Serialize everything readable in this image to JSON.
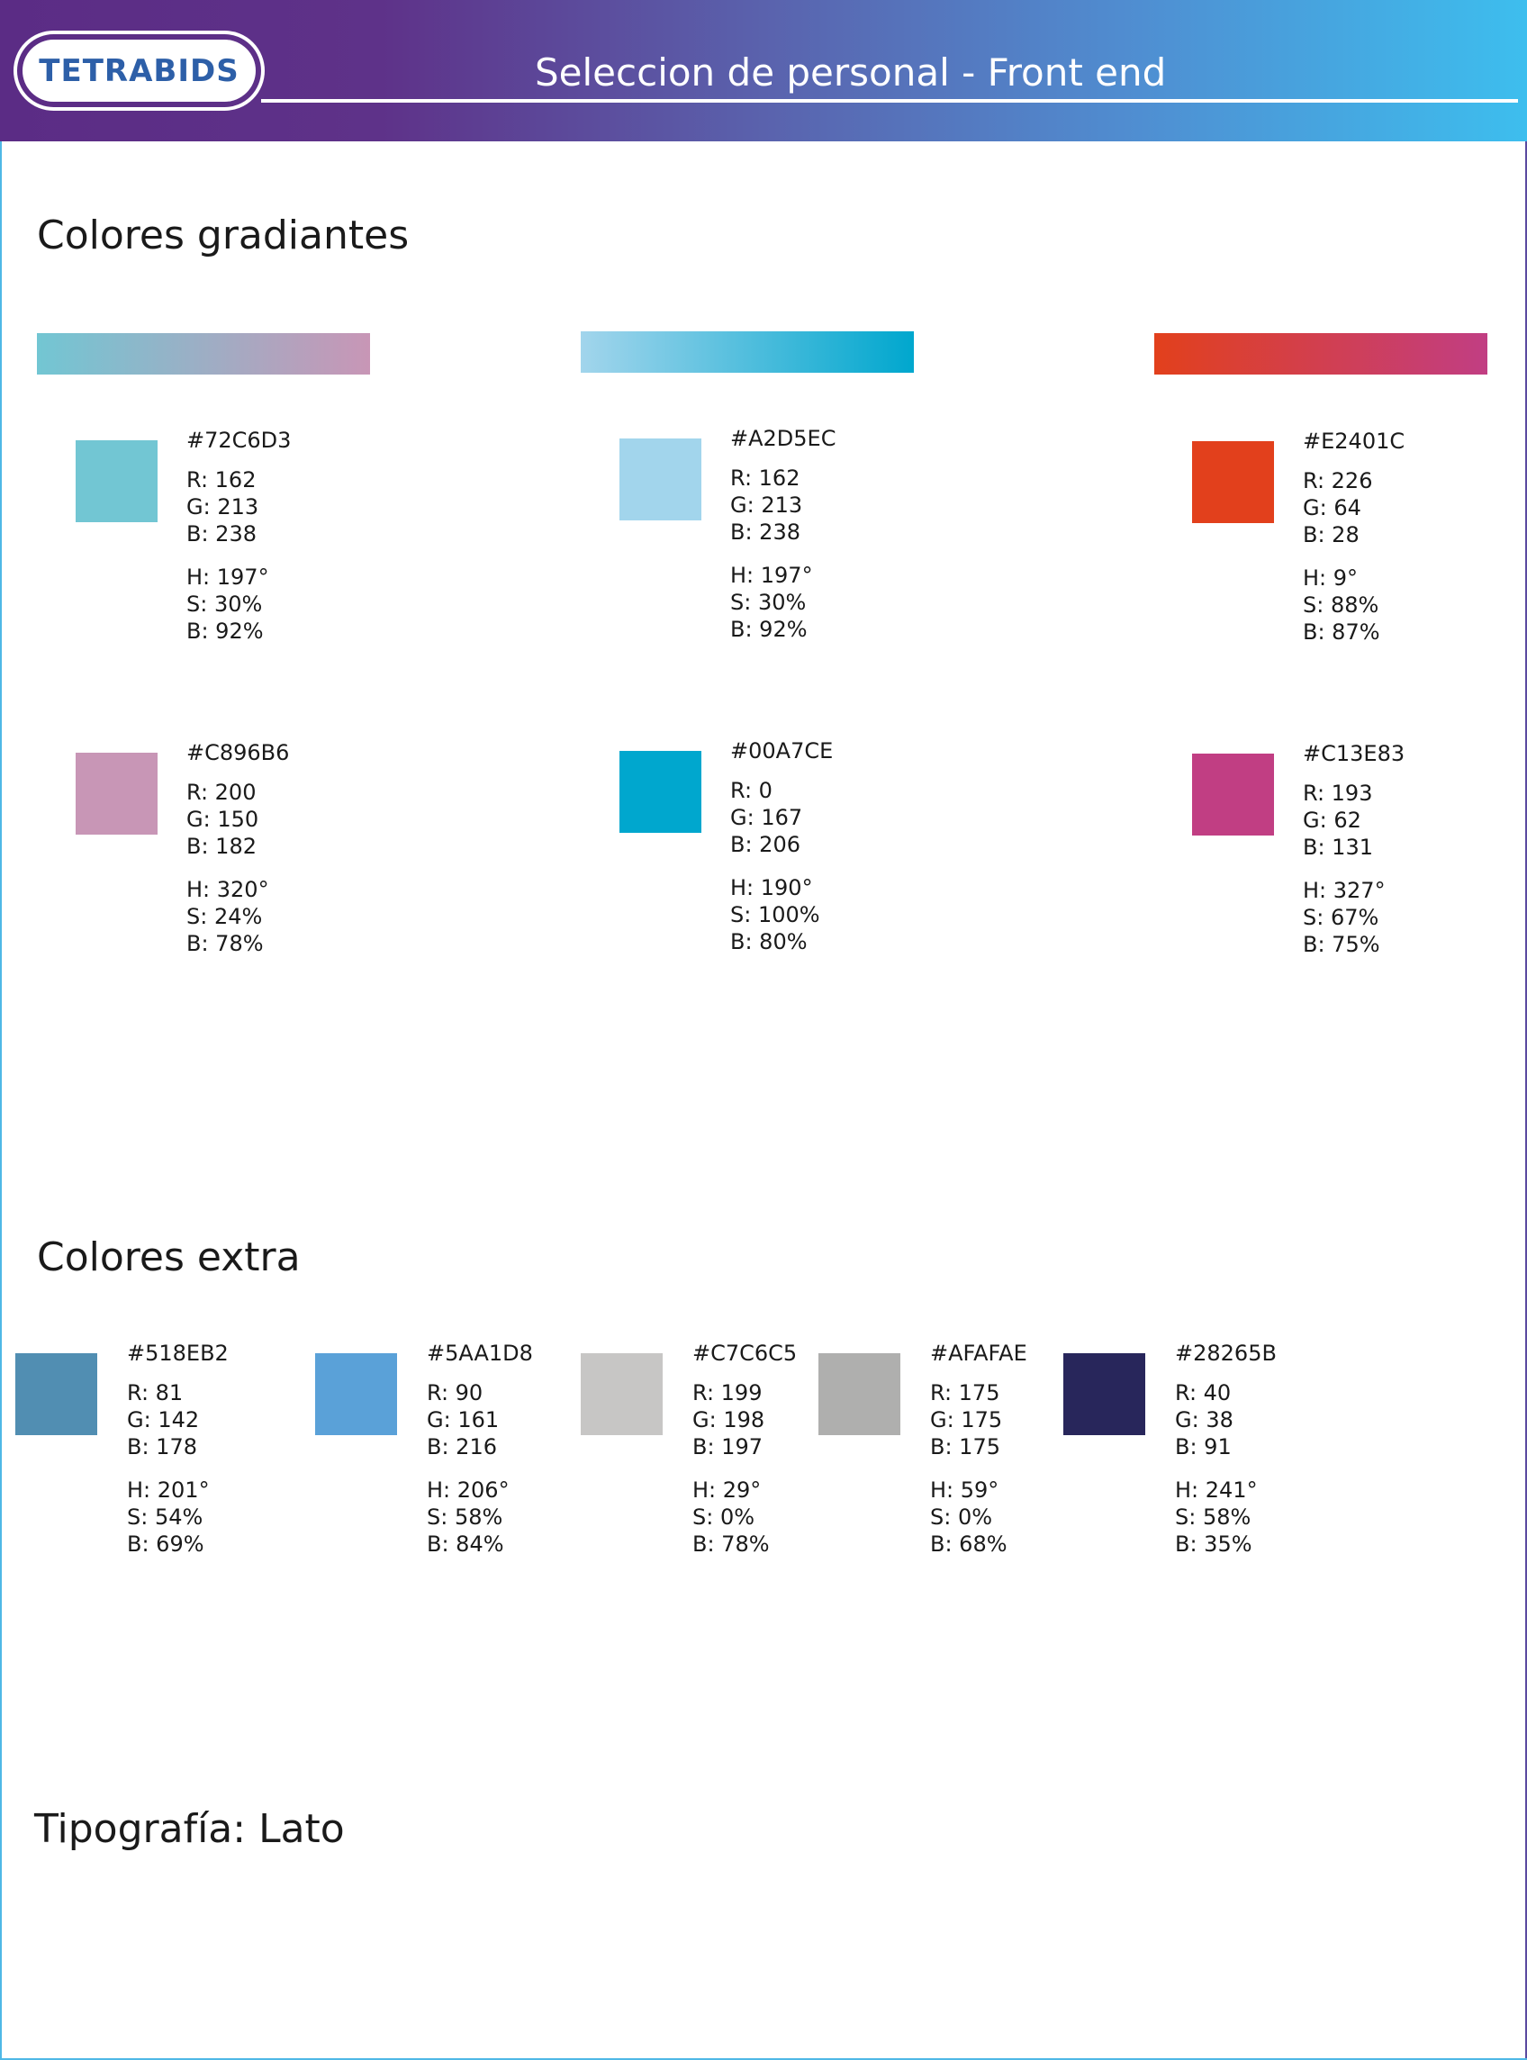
{
  "header": {
    "logo_text": "TETRABIDS",
    "title": "Seleccion de personal - Front end",
    "colors": {
      "gradient_start": "#5b2c85",
      "gradient_end": "#3dbeee"
    }
  },
  "sections": {
    "gradients_title": "Colores  gradiantes",
    "extra_title": "Colores extra",
    "typography_title": "Tipografía: Lato"
  },
  "gradients": [
    {
      "bar": [
        "#72C6D3",
        "#C896B6"
      ]
    },
    {
      "bar": [
        "#A2D5EC",
        "#00A7CE"
      ]
    },
    {
      "bar": [
        "#E2401C",
        "#C13E83"
      ]
    }
  ],
  "gradient_colors": [
    {
      "swatch": "#72C6D3",
      "hex": "#72C6D3",
      "r": "R: 162",
      "g": "G: 213",
      "b": "B: 238",
      "h": "H: 197°",
      "s": "S: 30%",
      "v": "B: 92%"
    },
    {
      "swatch": "#A2D5EC",
      "hex": "#A2D5EC",
      "r": "R: 162",
      "g": "G: 213",
      "b": "B: 238",
      "h": "H: 197°",
      "s": "S: 30%",
      "v": "B: 92%"
    },
    {
      "swatch": "#E2401C",
      "hex": "#E2401C",
      "r": "R: 226",
      "g": "G: 64",
      "b": "B: 28",
      "h": "H: 9°",
      "s": "S: 88%",
      "v": "B: 87%"
    },
    {
      "swatch": "#C896B6",
      "hex": "#C896B6",
      "r": "R: 200",
      "g": "G: 150",
      "b": "B: 182",
      "h": "H: 320°",
      "s": "S: 24%",
      "v": "B: 78%"
    },
    {
      "swatch": "#00A7CE",
      "hex": "#00A7CE",
      "r": "R: 0",
      "g": "G: 167",
      "b": "B: 206",
      "h": "H: 190°",
      "s": "S: 100%",
      "v": "B: 80%"
    },
    {
      "swatch": "#C13E83",
      "hex": "#C13E83",
      "r": "R: 193",
      "g": "G: 62",
      "b": "B: 131",
      "h": "H: 327°",
      "s": "S: 67%",
      "v": "B: 75%"
    }
  ],
  "extra_colors": [
    {
      "swatch": "#518EB2",
      "hex": "#518EB2",
      "r": "R: 81",
      "g": "G: 142",
      "b": "B: 178",
      "h": "H: 201°",
      "s": "S: 54%",
      "v": "B: 69%"
    },
    {
      "swatch": "#5AA1D8",
      "hex": "#5AA1D8",
      "r": "R: 90",
      "g": "G: 161",
      "b": "B: 216",
      "h": "H: 206°",
      "s": "S: 58%",
      "v": "B: 84%"
    },
    {
      "swatch": "#C7C6C5",
      "hex": "#C7C6C5",
      "r": "R: 199",
      "g": "G: 198",
      "b": "B: 197",
      "h": "H: 29°",
      "s": "S: 0%",
      "v": "B: 78%"
    },
    {
      "swatch": "#AFAFAE",
      "hex": "#AFAFAE",
      "r": "R: 175",
      "g": "G: 175",
      "b": "B: 175",
      "h": "H: 59°",
      "s": "S: 0%",
      "v": "B: 68%"
    },
    {
      "swatch": "#28265B",
      "hex": "#28265B",
      "r": "R: 40",
      "g": "G: 38",
      "b": "B: 91",
      "h": "H: 241°",
      "s": "S: 58%",
      "v": "B: 35%"
    }
  ]
}
